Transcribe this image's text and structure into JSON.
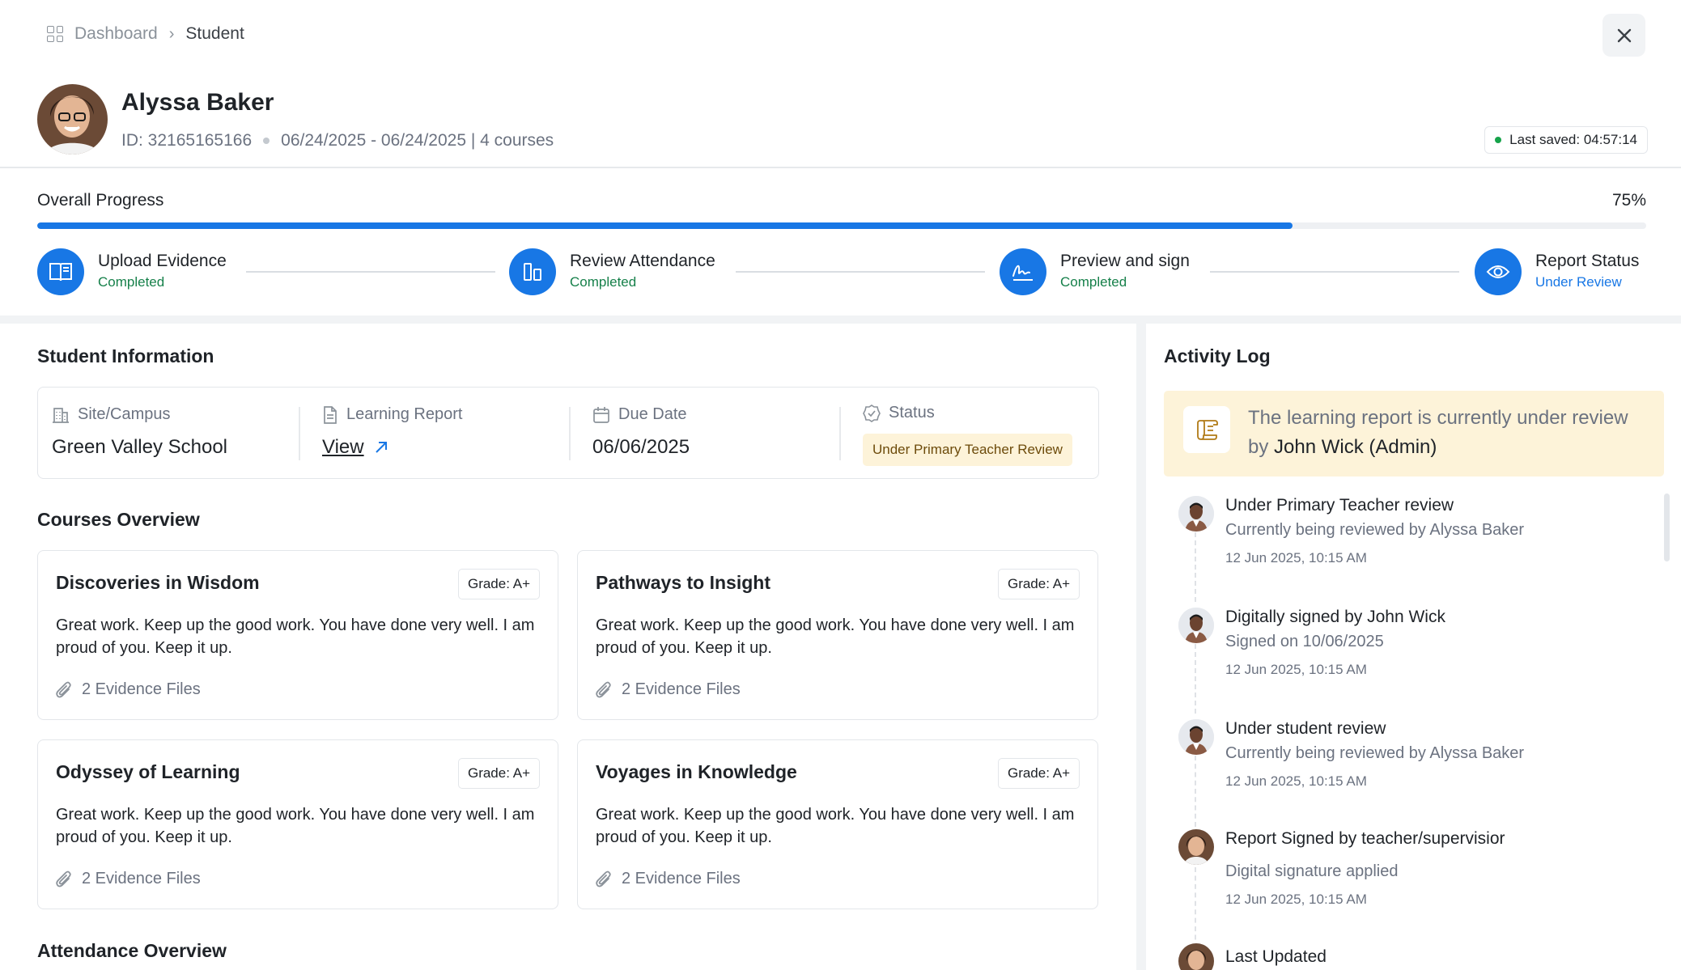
{
  "breadcrumb": {
    "root": "Dashboard",
    "separator": "›",
    "current": "Student"
  },
  "student": {
    "name": "Alyssa Baker",
    "id_text": "ID: 32165165166",
    "dates_courses": "06/24/2025 - 06/24/2025 | 4 courses",
    "last_saved": "Last saved: 04:57:14"
  },
  "progress": {
    "title": "Overall Progress",
    "percent_label": "75%",
    "percent_value": 78,
    "steps": [
      {
        "label": "Upload Evidence",
        "status": "Completed",
        "icon": "book-icon"
      },
      {
        "label": "Review Attendance",
        "status": "Completed",
        "icon": "bar-chart-icon"
      },
      {
        "label": "Preview and sign",
        "status": "Completed",
        "icon": "signature-icon"
      },
      {
        "label": "Report Status",
        "status": "Under Review",
        "icon": "eye-icon"
      }
    ]
  },
  "student_info": {
    "title": "Student Information",
    "site_label": "Site/Campus",
    "site_value": "Green Valley School",
    "report_label": "Learning Report",
    "report_link": "View",
    "due_label": "Due Date",
    "due_value": "06/06/2025",
    "status_label": "Status",
    "status_value": "Under Primary Teacher Review"
  },
  "courses": {
    "title": "Courses Overview",
    "items": [
      {
        "title": "Discoveries in Wisdom",
        "grade": "Grade: A+",
        "comment": "Great work. Keep up the good work. You have done very well. I am proud of you. Keep it up.",
        "evidence": "2 Evidence Files"
      },
      {
        "title": "Pathways to Insight",
        "grade": "Grade: A+",
        "comment": "Great work. Keep up the good work. You have done very well. I am proud of you. Keep it up.",
        "evidence": "2 Evidence Files"
      },
      {
        "title": "Odyssey of Learning",
        "grade": "Grade: A+",
        "comment": "Great work. Keep up the good work. You have done very well. I am proud of you. Keep it up.",
        "evidence": "2 Evidence Files"
      },
      {
        "title": "Voyages in Knowledge",
        "grade": "Grade: A+",
        "comment": "Great work. Keep up the good work. You have done very well. I am proud of you. Keep it up.",
        "evidence": "2 Evidence Files"
      }
    ]
  },
  "attendance": {
    "title": "Attendance Overview"
  },
  "activity": {
    "title": "Activity Log",
    "notice_prefix": "The learning report is currently under review by ",
    "notice_name": "John Wick (Admin)",
    "items": [
      {
        "title": "Under Primary Teacher review",
        "desc": "Currently being reviewed by Alyssa Baker",
        "time": "12 Jun 2025, 10:15 AM"
      },
      {
        "title": "Digitally signed by John Wick",
        "desc": "Signed on 10/06/2025",
        "time": "12 Jun 2025, 10:15 AM"
      },
      {
        "title": "Under student review",
        "desc": "Currently being reviewed by Alyssa Baker",
        "time": "12 Jun 2025, 10:15 AM"
      },
      {
        "title": "Report Signed by  teacher/supervisior",
        "desc": "Digital signature applied",
        "time": "12 Jun 2025, 10:15 AM"
      },
      {
        "title": "Last Updated",
        "desc": "",
        "time": ""
      }
    ]
  },
  "colors": {
    "primary": "#1877e5",
    "success": "#16804a",
    "warning_bg": "#fdf3d9",
    "border": "#e3e6ea"
  }
}
